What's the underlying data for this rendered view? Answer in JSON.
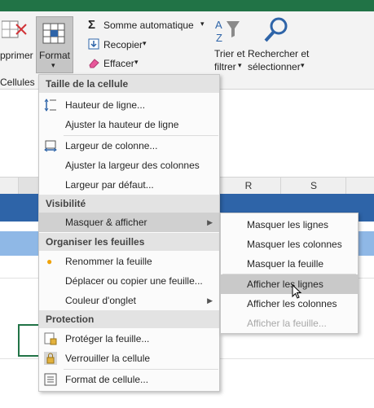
{
  "ribbon": {
    "supprimer_label": "pprimer",
    "cellules_label": "Cellules",
    "format_label": "Format",
    "somme_label": "Somme automatique",
    "recopier_label": "Recopier",
    "effacer_label": "Effacer",
    "trier_line1": "Trier et",
    "trier_line2": "filtrer",
    "rechercher_line1": "Rechercher et",
    "rechercher_line2": "sélectionner"
  },
  "sheet": {
    "columns": [
      "R",
      "S"
    ]
  },
  "menu": {
    "sections": {
      "taille": "Taille de la cellule",
      "visibilite": "Visibilité",
      "organiser": "Organiser les feuilles",
      "protection": "Protection"
    },
    "items": {
      "hauteur_ligne": "Hauteur de ligne...",
      "ajuster_hauteur": "Ajuster la hauteur de ligne",
      "largeur_colonne": "Largeur de colonne...",
      "ajuster_largeur": "Ajuster la largeur des colonnes",
      "largeur_defaut": "Largeur par défaut...",
      "masquer_afficher": "Masquer & afficher",
      "renommer": "Renommer la feuille",
      "deplacer_copier": "Déplacer ou copier une feuille...",
      "couleur_onglet": "Couleur d'onglet",
      "proteger": "Protéger la feuille...",
      "verrouiller": "Verrouiller la cellule",
      "format_cellule": "Format de cellule..."
    }
  },
  "submenu": {
    "masquer_lignes": "Masquer les lignes",
    "masquer_colonnes": "Masquer les colonnes",
    "masquer_feuille": "Masquer la feuille",
    "afficher_lignes": "Afficher les lignes",
    "afficher_colonnes": "Afficher les colonnes",
    "afficher_feuille": "Afficher la feuille..."
  },
  "colors": {
    "excel_green": "#217346",
    "header_blue": "#2e64a8",
    "light_blue": "#8fb8e6",
    "rename_dot": "#f0a30a"
  }
}
